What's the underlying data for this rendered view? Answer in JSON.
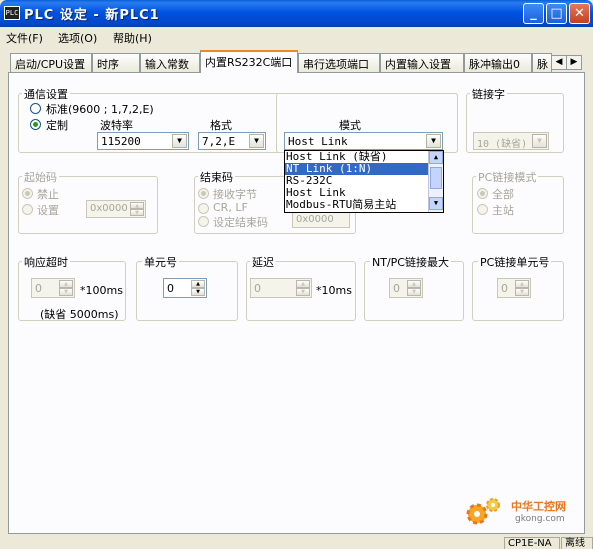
{
  "window": {
    "title": "PLC 设定 - 新PLC1",
    "icon_text": "PLC",
    "buttons": {
      "minimize": "_",
      "maximize": "□",
      "close": "✕"
    }
  },
  "menu": [
    {
      "label": "文件(F)"
    },
    {
      "label": "选项(O)"
    },
    {
      "label": "帮助(H)"
    }
  ],
  "tabs": [
    {
      "label": "启动/CPU设置"
    },
    {
      "label": "时序"
    },
    {
      "label": "输入常数"
    },
    {
      "label": "内置RS232C端口"
    },
    {
      "label": "串行选项端口"
    },
    {
      "label": "内置输入设置"
    },
    {
      "label": "脉冲输出0"
    },
    {
      "label": "脉"
    }
  ],
  "tab_scroll": {
    "left": "◀",
    "right": "▶"
  },
  "comm": {
    "title": "通信设置",
    "standard_label": "标准(9600 ; 1,7,2,E)",
    "custom_label": "定制",
    "baud_label": "波特率",
    "baud_value": "115200",
    "format_label": "格式",
    "format_value": "7,2,E",
    "mode_label": "模式",
    "mode_value": "Host Link"
  },
  "mode_options": [
    {
      "label": "Host Link (缺省)"
    },
    {
      "label": "NT Link (1:N)"
    },
    {
      "label": "RS-232C"
    },
    {
      "label": "Host Link"
    },
    {
      "label": "Modbus-RTU简易主站"
    }
  ],
  "link_word": {
    "title": "链接字",
    "value": "10 (缺省)"
  },
  "start_code": {
    "title": "起始码",
    "disable_label": "禁止",
    "set_label": "设置",
    "value": "0x0000"
  },
  "end_code": {
    "title": "结束码",
    "receive_bytes_label": "接收字节",
    "crlf_label": "CR, LF",
    "set_end_code_label": "设定结束码",
    "value": "0x0000"
  },
  "pc_link_mode": {
    "title": "PC链接模式",
    "all_label": "全部",
    "master_label": "主站"
  },
  "response_timeout": {
    "title": "响应超时",
    "value": "0",
    "unit": "*100ms",
    "default_note": "(缺省 5000ms)"
  },
  "unit_no": {
    "title": "单元号",
    "value": "0"
  },
  "delay": {
    "title": "延迟",
    "value": "0",
    "unit": "*10ms"
  },
  "nt_pc_max": {
    "title": "NT/PC链接最大",
    "value": "0"
  },
  "pc_link_unit": {
    "title": "PC链接单元号",
    "value": "0"
  },
  "status_bar": {
    "model": "CP1E-NA",
    "state": "离线"
  },
  "watermark": {
    "site": "中华工控网",
    "url": "gkong.com"
  }
}
